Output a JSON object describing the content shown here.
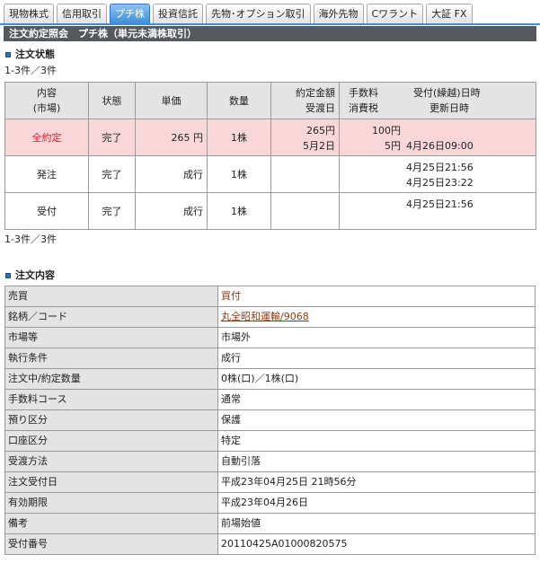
{
  "tabs": [
    {
      "label": "現物株式",
      "active": false
    },
    {
      "label": "信用取引",
      "active": false
    },
    {
      "label": "プチ株",
      "active": true
    },
    {
      "label": "投資信託",
      "active": false
    },
    {
      "label": "先物･オプション取引",
      "active": false
    },
    {
      "label": "海外先物",
      "active": false
    },
    {
      "label": "Cワラント",
      "active": false
    },
    {
      "label": "大証 FX",
      "active": false
    }
  ],
  "header": {
    "title": "注文約定照会　プチ株（単元未満株取引）"
  },
  "status_section": {
    "title": "注文状態",
    "count_top": "1-3件／3件",
    "count_bottom": "1-3件／3件",
    "columns": {
      "content_line1": "内容",
      "content_line2": "(市場)",
      "state": "状態",
      "price": "単価",
      "qty": "数量",
      "amount_line1": "約定金額",
      "amount_line2": "受渡日",
      "fee_line1": "手数料",
      "fee_line2": "消費税",
      "date_line1": "受付(繰越)日時",
      "date_line2": "更新日時"
    },
    "rows": [
      {
        "content": "全約定",
        "state": "完了",
        "price": "265 円",
        "qty": "1株",
        "amount": "265円",
        "delivery": "5月2日",
        "fee": "100円",
        "tax": "5円",
        "date1": "",
        "date2": "4月26日09:00"
      },
      {
        "content": "発注",
        "state": "完了",
        "price": "成行",
        "qty": "1株",
        "amount": "",
        "delivery": "",
        "fee": "",
        "tax": "",
        "date1": "4月25日21:56",
        "date2": "4月25日23:22"
      },
      {
        "content": "受付",
        "state": "完了",
        "price": "成行",
        "qty": "1株",
        "amount": "",
        "delivery": "",
        "fee": "",
        "tax": "",
        "date1": "",
        "date2": "4月25日21:56"
      }
    ]
  },
  "detail_section": {
    "title": "注文内容",
    "rows": [
      {
        "label": "売買",
        "value": "買付"
      },
      {
        "label": "銘柄／コード",
        "value": "丸全昭和運輸/9068"
      },
      {
        "label": "市場等",
        "value": "市場外"
      },
      {
        "label": "執行条件",
        "value": "成行"
      },
      {
        "label": "注文中/約定数量",
        "value": "0株(口)／1株(口)"
      },
      {
        "label": "手数料コース",
        "value": "通常"
      },
      {
        "label": "預り区分",
        "value": "保護"
      },
      {
        "label": "口座区分",
        "value": "特定"
      },
      {
        "label": "受渡方法",
        "value": "自動引落"
      },
      {
        "label": "注文受付日",
        "value": "平成23年04月25日 21時56分"
      },
      {
        "label": "有効期限",
        "value": "平成23年04月26日"
      },
      {
        "label": "備考",
        "value": "前場始値"
      },
      {
        "label": "受付番号",
        "value": "20110425A01000820575"
      }
    ]
  }
}
